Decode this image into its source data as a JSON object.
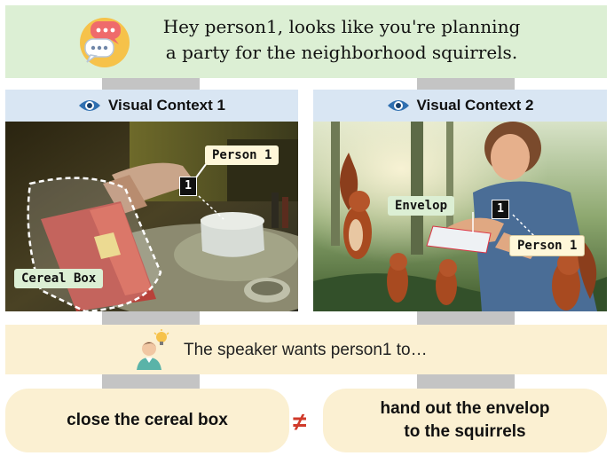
{
  "banner": {
    "line1": "Hey person1, looks like you're planning",
    "line2": "a party for the neighborhood squirrels."
  },
  "context1": {
    "title": "Visual Context 1",
    "person_label": "Person 1",
    "person_number": "1",
    "object_label": "Cereal Box"
  },
  "context2": {
    "title": "Visual Context 2",
    "object_label": "Envelop",
    "person_label": "Person 1",
    "person_number": "1"
  },
  "speaker": {
    "text": "The speaker wants person1 to…"
  },
  "answers": {
    "left": "close the cereal box",
    "right_line1": "hand out the envelop",
    "right_line2": "to the squirrels",
    "neq": "≠"
  },
  "colors": {
    "banner_green": "#dcefd4",
    "header_blue": "#d9e6f3",
    "answer_cream": "#fbf0d2",
    "neq_red": "#d03a2a"
  },
  "icons": [
    "speech-bubbles-icon",
    "eye-icon",
    "lightbulb-person-icon"
  ]
}
